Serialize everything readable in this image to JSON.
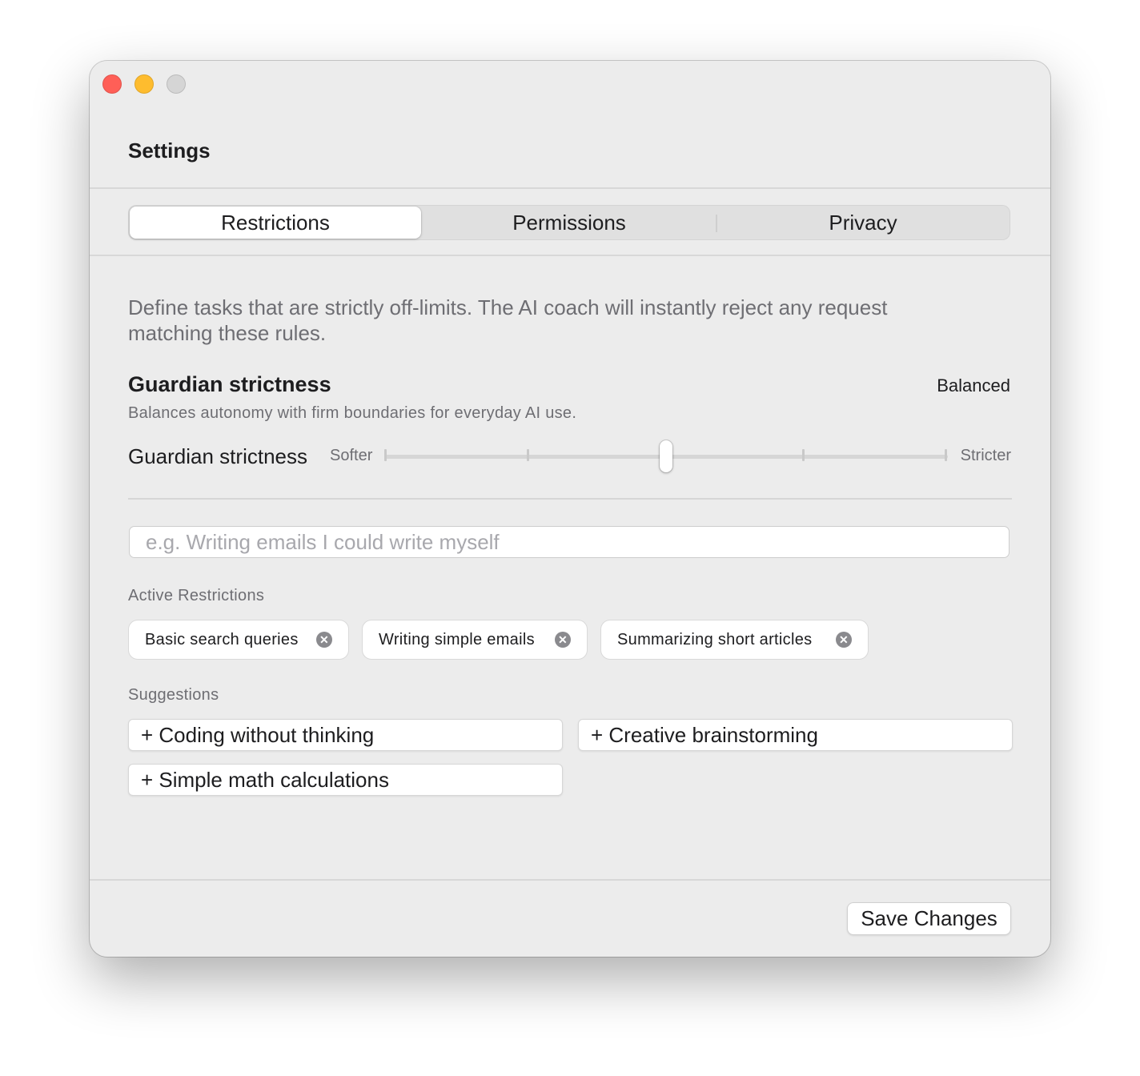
{
  "window": {
    "title": "Settings",
    "controls": [
      "close-icon",
      "minimize-icon",
      "zoom-icon"
    ]
  },
  "tabs": [
    {
      "label": "Restrictions",
      "selected": true
    },
    {
      "label": "Permissions",
      "selected": false
    },
    {
      "label": "Privacy",
      "selected": false
    }
  ],
  "restrictions": {
    "description": "Define tasks that are strictly off-limits. The AI coach will instantly reject any request matching these rules.",
    "strictness": {
      "title": "Guardian strictness",
      "level": "Balanced",
      "subtitle": "Balances autonomy with firm boundaries for everyday AI use.",
      "slider_label": "Guardian strictness",
      "min_label": "Softer",
      "max_label": "Stricter",
      "steps": 5,
      "value_fraction": 0.5
    },
    "input": {
      "placeholder": "e.g. Writing emails I could write myself",
      "value": ""
    },
    "active_label": "Active Restrictions",
    "active": [
      {
        "label": "Basic search queries"
      },
      {
        "label": "Writing simple emails"
      },
      {
        "label": "Summarizing short articles"
      }
    ],
    "suggestions_label": "Suggestions",
    "suggestions": [
      {
        "label": "+ Coding without thinking"
      },
      {
        "label": "+ Creative brainstorming"
      },
      {
        "label": "+ Simple math calculations"
      }
    ]
  },
  "footer": {
    "save_label": "Save Changes"
  },
  "colors": {
    "window_bg": "#ececec",
    "close": "#ff5f57",
    "minimize": "#febc2e",
    "zoom_disabled": "#d5d5d5",
    "secondary_text": "#6e6e73"
  }
}
